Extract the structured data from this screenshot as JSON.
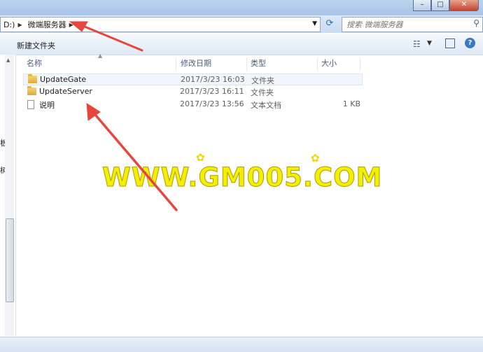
{
  "address": {
    "drive_fragment": "D:)",
    "current_folder": "微端服务器",
    "search_placeholder": "搜索 微端服务器"
  },
  "toolbar": {
    "new_folder_label": "新建文件夹"
  },
  "left_pane_fragments": [
    "板",
    "树"
  ],
  "columns": {
    "name": "名称",
    "date": "修改日期",
    "type": "类型",
    "size": "大小"
  },
  "files": [
    {
      "name": "UpdateGate",
      "date": "2017/3/23 16:03",
      "type": "文件夹",
      "size": "",
      "icon": "folder-icon"
    },
    {
      "name": "UpdateServer",
      "date": "2017/3/23 16:11",
      "type": "文件夹",
      "size": "",
      "icon": "folder-icon"
    },
    {
      "name": "说明",
      "date": "2017/3/23 13:56",
      "type": "文本文档",
      "size": "1 KB",
      "icon": "text-file-icon"
    }
  ],
  "watermark": "WWW.GM005.COM",
  "annotation_color": "#e8453c"
}
